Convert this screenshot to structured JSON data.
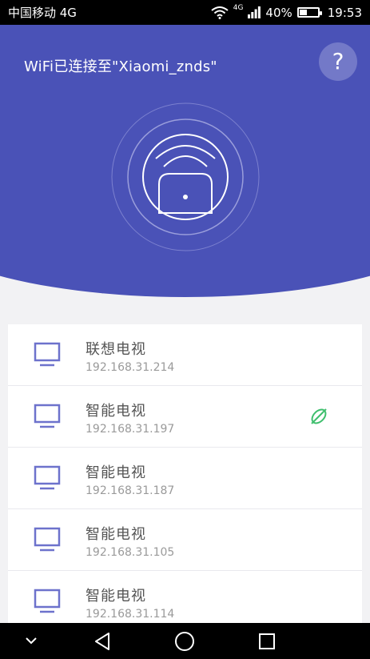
{
  "status_bar": {
    "carrier": "中国移动 4G",
    "network_badge": "4G",
    "battery": "40%",
    "battery_level": 0.4,
    "time": "19:53"
  },
  "header": {
    "title": "WiFi已连接至\"Xiaomi_znds\"",
    "help_label": "?",
    "icons": [
      "wifi-router-icon",
      "help-icon"
    ]
  },
  "devices": [
    {
      "name": "联想电视",
      "ip": "192.168.31.214",
      "connected": false
    },
    {
      "name": "智能电视",
      "ip": "192.168.31.197",
      "connected": true
    },
    {
      "name": "智能电视",
      "ip": "192.168.31.187",
      "connected": false
    },
    {
      "name": "智能电视",
      "ip": "192.168.31.105",
      "connected": false
    },
    {
      "name": "智能电视",
      "ip": "192.168.31.114",
      "connected": false
    }
  ],
  "colors": {
    "accent": "#4a52b7",
    "connected": "#3fbf6e",
    "tv_icon": "#6d72cc"
  },
  "nav": {
    "icons": [
      "chevron-down-icon",
      "back-triangle-icon",
      "home-circle-icon",
      "recents-square-icon"
    ]
  }
}
